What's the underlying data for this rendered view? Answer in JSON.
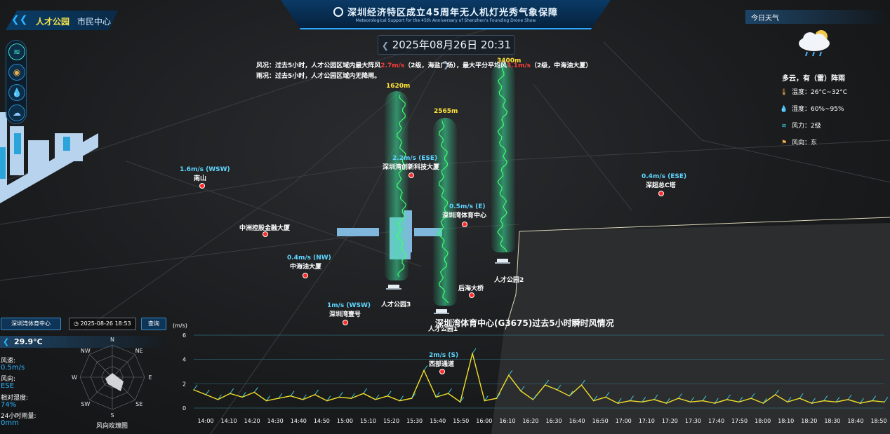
{
  "header": {
    "title": "深圳经济特区成立45周年无人机灯光秀气象保障",
    "subtitle": "Meteorological Support for the 45th Anniversary of Shenzhen's Founding Drone Show"
  },
  "left_tab": {
    "primary": "人才公园",
    "secondary": "市民中心"
  },
  "datetime": "2025年08月26日 20:31",
  "info": {
    "wind_prefix": "风况：过去5小时，人才公园区域内最大阵风",
    "wind_max": "2.7m/s",
    "wind_mid": "（2级，海盐广场），最大平分平均风",
    "wind_avg": "3.1m/s",
    "wind_suffix": "（2级，中海油大厦）",
    "rain": "雨况：过去5小时，人才公园区域内无降雨。"
  },
  "weather": {
    "title": "今日天气",
    "condition": "多云，有（雷）阵雨",
    "temperature": "温度：26°C~32°C",
    "humidity": "湿度：60%~95%",
    "wind_force": "风力：2级",
    "wind_dir": "风向：东"
  },
  "stations": [
    {
      "wind": "1.6m/s (WSW)",
      "name": "南山"
    },
    {
      "wind": "2.2m/s (ESE)",
      "name": "深圳湾创新科技大厦"
    },
    {
      "wind": "",
      "name": "中洲控股金融大厦"
    },
    {
      "wind": "0.5m/s (E)",
      "name": "深圳湾体育中心"
    },
    {
      "wind": "0.4m/s (NW)",
      "name": "中海油大厦"
    },
    {
      "wind": "0.4m/s (ESE)",
      "name": "深超总C塔"
    },
    {
      "wind": "",
      "name": "后海大桥"
    },
    {
      "wind": "1m/s (WSW)",
      "name": "深圳湾壹号"
    },
    {
      "wind": "2m/s (S)",
      "name": "西部通道"
    }
  ],
  "altitudes": [
    "1620m",
    "2565m",
    "3400m"
  ],
  "parks": [
    "人才公园3",
    "人才公园1",
    "人才公园2"
  ],
  "controls": {
    "station_btn": "深圳湾体育中心",
    "date_value": "2025-08-26 18:53",
    "query_btn": "查询"
  },
  "left_panel": {
    "temp": "29.9°C",
    "speed_label": "风速:",
    "speed_value": "0.5m/s",
    "dir_label": "风向:",
    "dir_value": "ESE",
    "humidity_label": "相对湿度:",
    "humidity_value": "74%",
    "rain_label": "24小时雨量:",
    "rain_value": "0mm",
    "rose_caption": "风向玫瑰图",
    "rose_dirs": [
      "N",
      "NE",
      "E",
      "SE",
      "S",
      "SW",
      "W",
      "NW"
    ]
  },
  "chart_data": {
    "type": "line",
    "title": "深圳湾体育中心(G3675)过去5小时瞬时风情况",
    "ylabel": "(m/s)",
    "xlabel": "",
    "ylim": [
      0,
      6
    ],
    "yticks": [
      0,
      2,
      4,
      6
    ],
    "grid": true,
    "legend": "none",
    "xticks": [
      "14:00",
      "14:10",
      "14:20",
      "14:30",
      "14:40",
      "14:50",
      "15:00",
      "15:10",
      "15:20",
      "15:30",
      "15:40",
      "15:50",
      "16:00",
      "16:10",
      "16:20",
      "16:30",
      "16:40",
      "16:50",
      "17:00",
      "17:10",
      "17:20",
      "17:30",
      "17:40",
      "17:50",
      "18:00",
      "18:10",
      "18:20",
      "18:30",
      "18:40",
      "18:50"
    ],
    "series": [
      {
        "values": [
          1.5,
          1.1,
          0.7,
          1.2,
          0.9,
          1.3,
          0.6,
          0.8,
          1.0,
          0.7,
          1.1,
          0.6,
          0.9,
          0.8,
          1.2,
          0.7,
          1.0,
          0.6,
          0.8,
          3.1,
          0.9,
          1.2,
          0.5,
          4.5,
          0.6,
          0.8,
          2.7,
          1.4,
          0.7,
          1.9,
          1.5,
          1.0,
          1.9,
          0.6,
          0.9,
          0.4,
          0.6,
          0.5,
          0.7,
          0.4,
          0.8,
          0.5,
          0.6,
          0.4,
          0.7,
          0.5,
          0.8,
          0.4,
          1.1,
          0.5,
          0.8,
          0.4,
          0.6,
          0.5,
          0.7,
          0.4,
          0.6,
          0.5
        ]
      }
    ]
  }
}
